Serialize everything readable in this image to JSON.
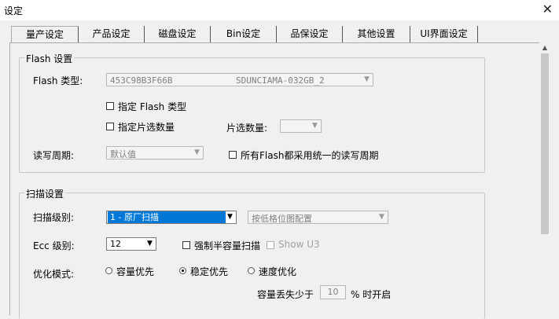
{
  "window": {
    "title": "设定",
    "close_glyph": "✕"
  },
  "tabs": [
    {
      "label": "量产设定"
    },
    {
      "label": "产品设定"
    },
    {
      "label": "磁盘设定"
    },
    {
      "label": "Bin设定"
    },
    {
      "label": "品保设定"
    },
    {
      "label": "其他设置"
    },
    {
      "label": "UI界面设定"
    }
  ],
  "flash_group": {
    "legend": "Flash 设置",
    "flash_type_label": "Flash 类型:",
    "flash_type_id": "453C98B3F66B",
    "flash_type_name": "SDUNCIAMA-032GB_2",
    "specify_flash_type": "指定 Flash 类型",
    "specify_chip_count": "指定片选数量",
    "chip_count_label": "片选数量:",
    "chip_count_value": "",
    "rw_cycle_label": "读写周期:",
    "rw_cycle_value": "默认值",
    "all_flash_unified": "所有Flash都采用统一的读写周期"
  },
  "scan_group": {
    "legend": "扫描设置",
    "scan_level_label": "扫描级别:",
    "scan_level_value": "1 - 原厂扫描",
    "scan_bitmap_value": "按低格位图配置",
    "ecc_label": "Ecc 级别:",
    "ecc_value": "12",
    "force_half_capacity": "强制半容量扫描",
    "show_u3": "Show U3",
    "optimize_label": "优化模式:",
    "opt_capacity": "容量优先",
    "opt_stable": "稳定优先",
    "opt_speed": "速度优化",
    "capacity_loss_label": "容量丢失少于",
    "capacity_loss_value": "10",
    "capacity_loss_suffix": "% 时开启",
    "selected_option": "稳定优先"
  },
  "icons": {
    "dropdown": "▼",
    "scroll_up": "▲"
  },
  "colors": {
    "selection": "#0078d7",
    "background": "#f0f0f0"
  }
}
